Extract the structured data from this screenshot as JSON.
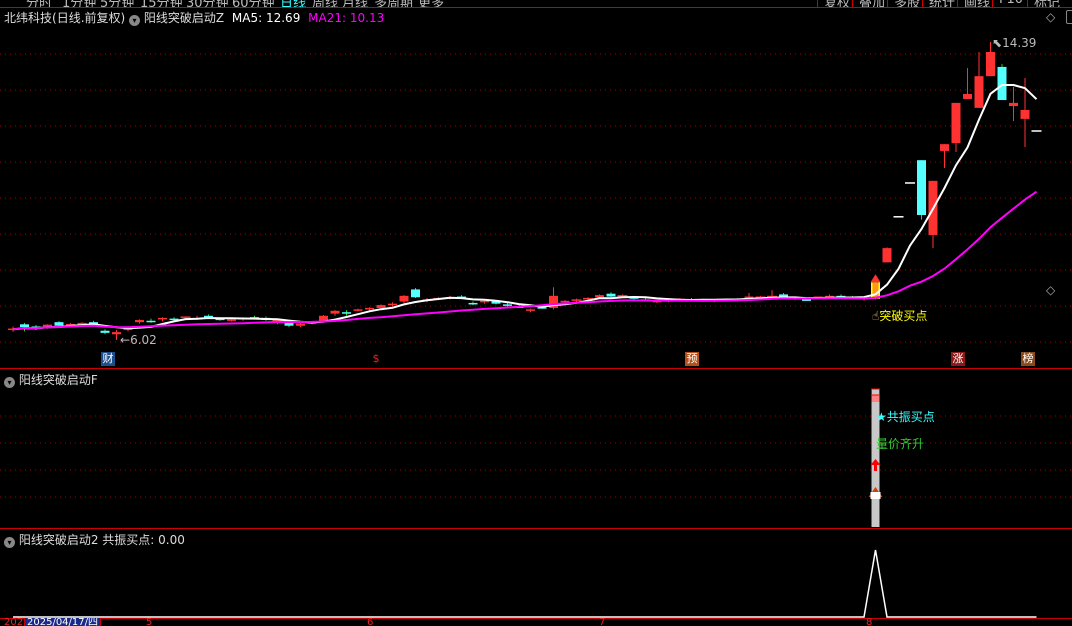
{
  "menu": {
    "tabs": [
      "分时",
      "1分钟",
      "5分钟",
      "15分钟",
      "30分钟",
      "60分钟",
      "日线",
      "周线",
      "月线",
      "多周期",
      "更多"
    ],
    "active_tab": "日线",
    "right_buttons": [
      "复权",
      "叠加",
      "多股",
      "统计",
      "画线",
      "F10",
      "标记"
    ]
  },
  "main_panel": {
    "stock_name": "北纬科技",
    "period": "(日线.前复权)",
    "indicator": "阳线突破启动Z",
    "ma5_label": "MA5: 12.69",
    "ma21_label": "MA21: 10.13",
    "high_label": "14.39",
    "low_label": "6.02",
    "signal_label": "突破买点",
    "event_tags": [
      {
        "text": "财",
        "color": "#1e4f8a"
      },
      {
        "text": "$",
        "color": "#e02020"
      },
      {
        "text": "预",
        "color": "#b5501a"
      },
      {
        "text": "涨",
        "color": "#8a1a1a"
      },
      {
        "text": "榜",
        "color": "#8a4a1a"
      }
    ]
  },
  "panel2": {
    "title": "阳线突破启动F",
    "label_star": "共振买点",
    "label_vol": "量价齐升"
  },
  "panel3": {
    "title": "阳线突破启动2",
    "value_label": "共振买点: 0.00"
  },
  "x_axis": {
    "year_label": "202",
    "cursor_date": "2025/04/17/四",
    "month_labels": [
      "5",
      "6",
      "7",
      "8"
    ]
  },
  "colors": {
    "up": "#ff3232",
    "down": "#54ffff",
    "ma5": "#ffffff",
    "ma21": "#ff00ff",
    "signal": "#ffff00",
    "grid": "#a00000"
  },
  "chart_data": {
    "type": "candlestick",
    "ohlc_format": [
      "open",
      "high",
      "low",
      "close"
    ],
    "ohlc": [
      [
        6.32,
        6.4,
        6.25,
        6.32
      ],
      [
        6.46,
        6.5,
        6.26,
        6.38
      ],
      [
        6.4,
        6.44,
        6.3,
        6.35
      ],
      [
        6.38,
        6.46,
        6.34,
        6.45
      ],
      [
        6.52,
        6.55,
        6.38,
        6.42
      ],
      [
        6.45,
        6.5,
        6.4,
        6.47
      ],
      [
        6.48,
        6.52,
        6.42,
        6.5
      ],
      [
        6.52,
        6.56,
        6.44,
        6.46
      ],
      [
        6.28,
        6.32,
        6.18,
        6.22
      ],
      [
        6.18,
        6.3,
        6.02,
        6.24
      ],
      [
        6.3,
        6.36,
        6.26,
        6.34
      ],
      [
        6.52,
        6.6,
        6.48,
        6.58
      ],
      [
        6.56,
        6.62,
        6.5,
        6.55
      ],
      [
        6.6,
        6.66,
        6.54,
        6.64
      ],
      [
        6.62,
        6.66,
        6.55,
        6.6
      ],
      [
        6.66,
        6.68,
        6.62,
        6.66
      ],
      [
        6.62,
        6.7,
        6.58,
        6.64
      ],
      [
        6.7,
        6.74,
        6.62,
        6.64
      ],
      [
        6.62,
        6.66,
        6.56,
        6.6
      ],
      [
        6.58,
        6.62,
        6.54,
        6.6
      ],
      [
        6.6,
        6.66,
        6.56,
        6.64
      ],
      [
        6.66,
        6.7,
        6.6,
        6.62
      ],
      [
        6.64,
        6.68,
        6.56,
        6.58
      ],
      [
        6.56,
        6.62,
        6.46,
        6.56
      ],
      [
        6.56,
        6.58,
        6.38,
        6.42
      ],
      [
        6.42,
        6.5,
        6.38,
        6.48
      ],
      [
        6.5,
        6.54,
        6.46,
        6.52
      ],
      [
        6.52,
        6.72,
        6.5,
        6.7
      ],
      [
        6.76,
        6.86,
        6.7,
        6.84
      ],
      [
        6.8,
        6.86,
        6.7,
        6.78
      ],
      [
        6.86,
        6.9,
        6.82,
        6.88
      ],
      [
        6.88,
        6.94,
        6.84,
        6.92
      ],
      [
        6.92,
        7.02,
        6.9,
        7.0
      ],
      [
        7.0,
        7.08,
        6.96,
        7.04
      ],
      [
        7.1,
        7.28,
        7.06,
        7.26
      ],
      [
        7.44,
        7.48,
        7.2,
        7.22
      ],
      [
        7.14,
        7.2,
        7.08,
        7.16
      ],
      [
        7.18,
        7.22,
        7.14,
        7.18
      ],
      [
        7.2,
        7.26,
        7.16,
        7.22
      ],
      [
        7.24,
        7.28,
        7.18,
        7.2
      ],
      [
        7.06,
        7.1,
        7.0,
        7.04
      ],
      [
        7.08,
        7.14,
        7.04,
        7.12
      ],
      [
        7.1,
        7.14,
        7.02,
        7.04
      ],
      [
        7.02,
        7.08,
        6.96,
        7.0
      ],
      [
        6.96,
        7.04,
        6.92,
        6.94
      ],
      [
        6.86,
        6.9,
        6.8,
        6.88
      ],
      [
        6.94,
        6.98,
        6.9,
        6.92
      ],
      [
        6.92,
        7.5,
        6.88,
        7.26
      ],
      [
        7.1,
        7.14,
        7.04,
        7.12
      ],
      [
        7.14,
        7.18,
        7.1,
        7.14
      ],
      [
        7.18,
        7.22,
        7.14,
        7.18
      ],
      [
        7.22,
        7.3,
        7.2,
        7.28
      ],
      [
        7.32,
        7.36,
        7.22,
        7.24
      ],
      [
        7.26,
        7.3,
        7.22,
        7.26
      ],
      [
        7.22,
        7.26,
        7.14,
        7.18
      ],
      [
        7.16,
        7.2,
        7.1,
        7.14
      ],
      [
        7.1,
        7.14,
        7.06,
        7.12
      ],
      [
        7.12,
        7.16,
        7.08,
        7.14
      ],
      [
        7.14,
        7.2,
        7.1,
        7.18
      ],
      [
        7.16,
        7.2,
        7.1,
        7.14
      ],
      [
        7.14,
        7.18,
        7.12,
        7.16
      ],
      [
        7.12,
        7.16,
        7.08,
        7.14
      ],
      [
        7.14,
        7.18,
        7.1,
        7.16
      ],
      [
        7.16,
        7.2,
        7.12,
        7.18
      ],
      [
        7.18,
        7.34,
        7.16,
        7.24
      ],
      [
        7.22,
        7.26,
        7.2,
        7.22
      ],
      [
        7.24,
        7.42,
        7.2,
        7.24
      ],
      [
        7.3,
        7.34,
        7.16,
        7.2
      ],
      [
        7.18,
        7.22,
        7.14,
        7.18
      ],
      [
        7.16,
        7.2,
        7.12,
        7.14
      ],
      [
        7.2,
        7.24,
        7.18,
        7.24
      ],
      [
        7.24,
        7.3,
        7.2,
        7.26
      ],
      [
        7.26,
        7.3,
        7.22,
        7.24
      ],
      [
        7.22,
        7.26,
        7.16,
        7.18
      ],
      [
        7.18,
        7.22,
        7.12,
        7.2
      ],
      [
        7.18,
        7.66,
        7.16,
        7.64
      ],
      [
        8.2,
        8.62,
        8.2,
        8.6
      ],
      [
        9.48,
        9.48,
        9.48,
        9.48
      ],
      [
        10.43,
        10.43,
        10.43,
        10.43
      ],
      [
        11.07,
        11.07,
        9.4,
        9.53
      ],
      [
        8.97,
        10.49,
        8.6,
        10.49
      ],
      [
        11.33,
        11.52,
        10.85,
        11.52
      ],
      [
        11.55,
        12.68,
        11.3,
        12.68
      ],
      [
        12.79,
        13.66,
        12.79,
        12.93
      ],
      [
        12.54,
        14.11,
        12.54,
        13.43
      ],
      [
        13.43,
        14.39,
        13.43,
        14.11
      ],
      [
        13.69,
        13.77,
        12.76,
        12.76
      ],
      [
        12.59,
        13.13,
        12.17,
        12.68
      ],
      [
        12.23,
        13.38,
        11.44,
        12.48
      ],
      [
        11.89,
        11.89,
        11.89,
        11.89
      ]
    ],
    "signal_bar_index": 75,
    "moving_averages": [
      {
        "name": "MA5",
        "period": 5
      },
      {
        "name": "MA21",
        "period": 21
      }
    ],
    "indicator_resonance": {
      "name": "共振买点",
      "values_nonzero": {
        "75": 1
      },
      "default": 0
    }
  }
}
